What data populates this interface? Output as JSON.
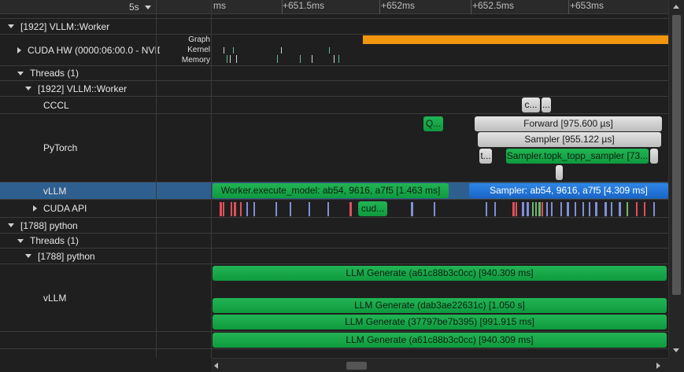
{
  "ruler": {
    "zoom": "5s",
    "ticks": [
      "ms",
      "+651.5ms",
      "+652ms",
      "+652.5ms",
      "+653ms"
    ]
  },
  "rows": {
    "worker_top": "[1922] VLLM::Worker",
    "cuda_hw": "CUDA HW (0000:06:00.0 - NVID",
    "cuda_hw_sublabels": [
      "Graph",
      "Kernel",
      "Memory"
    ],
    "threads1": "Threads (1)",
    "worker_thread": "[1922] VLLM::Worker",
    "cccl": "CCCL",
    "pytorch": "PyTorch",
    "vllm": "vLLM",
    "cuda_api": "CUDA API",
    "python": "[1788] python",
    "threads2": "Threads (1)",
    "python_thread": "[1788] python",
    "vllm2": "vLLM"
  },
  "bars": {
    "cccl_a": "c...",
    "cccl_b": "...",
    "pt_q": "Q...",
    "forward": "Forward [975.600 µs]",
    "sampler": "Sampler [955.122 µs]",
    "pt_t": "t...",
    "topk": "Sampler.topk_topp_sampler [73...",
    "execute_model": "Worker.execute_model: ab54, 9616, a7f5 [1.463 ms]",
    "sampler_vllm": "Sampler: ab54, 9616, a7f5 [4.309 ms]",
    "cuda_api": "cud...",
    "gen1": "LLM Generate (a61c88b3c0cc) [940.309 ms]",
    "gen2": "LLM Generate (dab3ae22631c) [1.050 s]",
    "gen3": "LLM Generate (37797be7b395) [991.915 ms]",
    "gen4": "LLM Generate (a61c88b3c0cc) [940.309 ms]"
  },
  "colors": {
    "green": "#1aa84a",
    "blue": "#2377d8",
    "orange": "#f2950f",
    "selected_row": "#2f5f8f"
  },
  "icons": [
    "expand-triangle-icon",
    "collapse-triangle-icon",
    "dropdown-arrow-icon",
    "scroll-arrow-icon"
  ]
}
